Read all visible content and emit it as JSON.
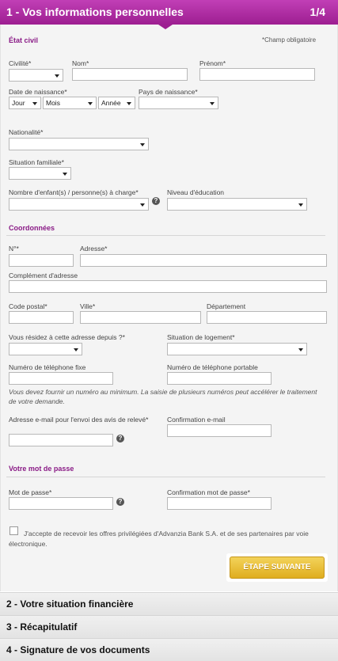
{
  "header": {
    "title": "1 - Vos informations personnelles",
    "step": "1/4"
  },
  "etat_civil": {
    "title": "État civil",
    "required_note": "*Champ obligatoire",
    "civilite_label": "Civilité*",
    "nom_label": "Nom*",
    "prenom_label": "Prénom*",
    "date_naissance_label": "Date de naissance*",
    "jour": "Jour",
    "mois": "Mois",
    "annee": "Année",
    "pays_label": "Pays de naissance*",
    "nationalite_label": "Nationalité*",
    "situation_label": "Situation familiale*",
    "enfants_label": "Nombre d'enfant(s) / personne(s) à charge*",
    "niveau_label": "Niveau d'éducation",
    "help_glyph": "?"
  },
  "coordonnees": {
    "title": "Coordonnées",
    "num_label": "N°*",
    "adresse_label": "Adresse*",
    "complement_label": "Complément d'adresse",
    "cp_label": "Code postal*",
    "ville_label": "Ville*",
    "departement_label": "Département",
    "depuis_label": "Vous résidez à cette adresse depuis ?*",
    "logement_label": "Situation de logement*",
    "tel_fixe_label": "Numéro de téléphone fixe",
    "tel_port_label": "Numéro de téléphone portable",
    "info": "Vous devez fournir un numéro au minimum. La saisie de plusieurs numéros peut accélérer le traitement de votre demande.",
    "email_label": "Adresse e-mail pour l'envoi des avis de relevé*",
    "email_conf_label": "Confirmation e-mail"
  },
  "mot_de_passe": {
    "title": "Votre mot de passe",
    "mdp_label": "Mot de passe*",
    "mdp_conf_label": "Confirmation mot de passe*"
  },
  "consent": "J'accepte de recevoir les offres privilégiées d'Advanzia Bank S.A. et de ses partenaires par voie électronique.",
  "next_button": "ÉTAPE SUIVANTE",
  "steps": [
    "2 - Votre situation financière",
    "3 - Récapitulatif",
    "4 - Signature de vos documents"
  ]
}
